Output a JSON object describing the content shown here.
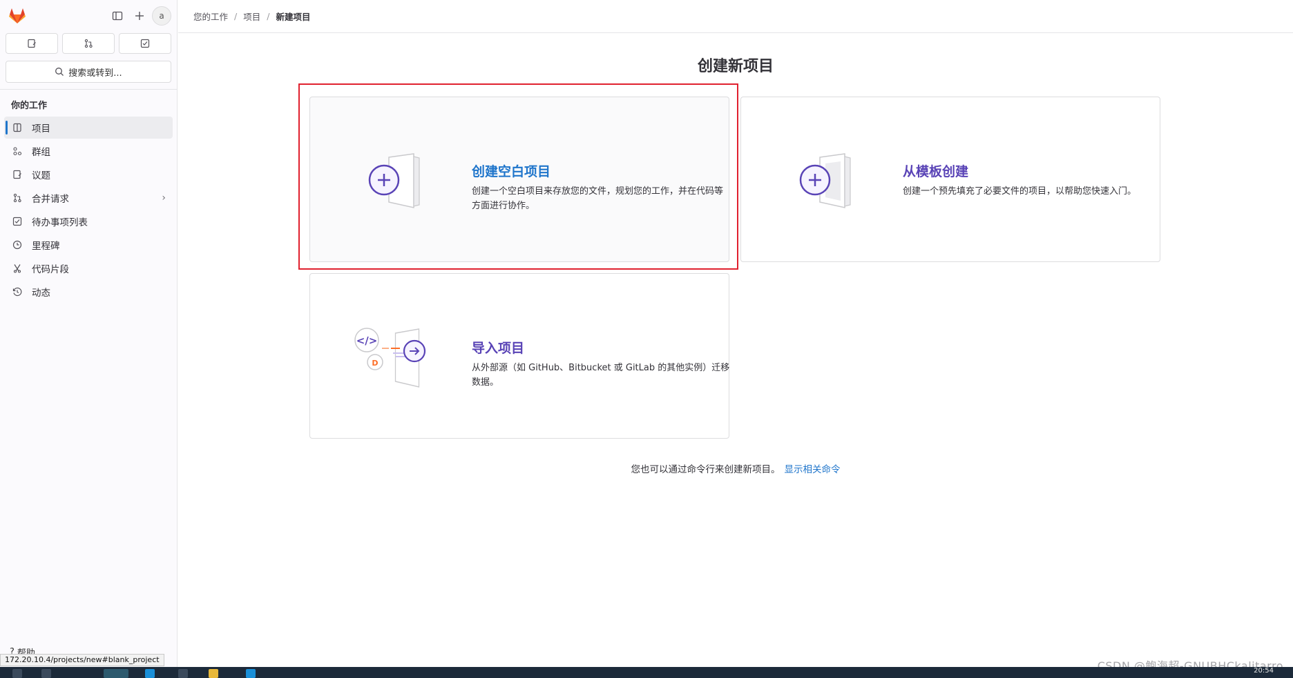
{
  "sidebar": {
    "search_placeholder": "搜索或转到...",
    "avatar_alt": "a",
    "section_title": "你的工作",
    "items": [
      {
        "label": "项目",
        "icon": "project-icon",
        "active": true
      },
      {
        "label": "群组",
        "icon": "group-icon"
      },
      {
        "label": "议题",
        "icon": "issues-icon"
      },
      {
        "label": "合并请求",
        "icon": "merge-request-icon"
      },
      {
        "label": "待办事项列表",
        "icon": "todo-icon"
      },
      {
        "label": "里程碑",
        "icon": "milestone-icon"
      },
      {
        "label": "代码片段",
        "icon": "snippet-icon"
      },
      {
        "label": "动态",
        "icon": "activity-icon"
      }
    ],
    "help_label": "帮助"
  },
  "breadcrumb": [
    "您的工作",
    "项目",
    "新建项目"
  ],
  "page_title": "创建新项目",
  "cards": {
    "blank": {
      "title": "创建空白项目",
      "desc": "创建一个空白项目来存放您的文件，规划您的工作，并在代码等方面进行协作。"
    },
    "template": {
      "title": "从模板创建",
      "desc": "创建一个预先填充了必要文件的项目，以帮助您快速入门。"
    },
    "import": {
      "title": "导入项目",
      "desc": "从外部源（如 GitHub、Bitbucket 或 GitLab 的其他实例）迁移数据。"
    }
  },
  "footer": {
    "text": "您也可以通过命令行来创建新项目。",
    "link": "显示相关命令"
  },
  "status_url": "172.20.10.4/projects/new#blank_project",
  "watermark": "CSDN @鲍海超-GNUBHCkalitarro",
  "clock": "20:54",
  "colors": {
    "accent_blue": "#1f75cb",
    "purple": "#5943b6",
    "highlight_red": "#e0202e",
    "gitlab_orange": "#fc6d26"
  }
}
